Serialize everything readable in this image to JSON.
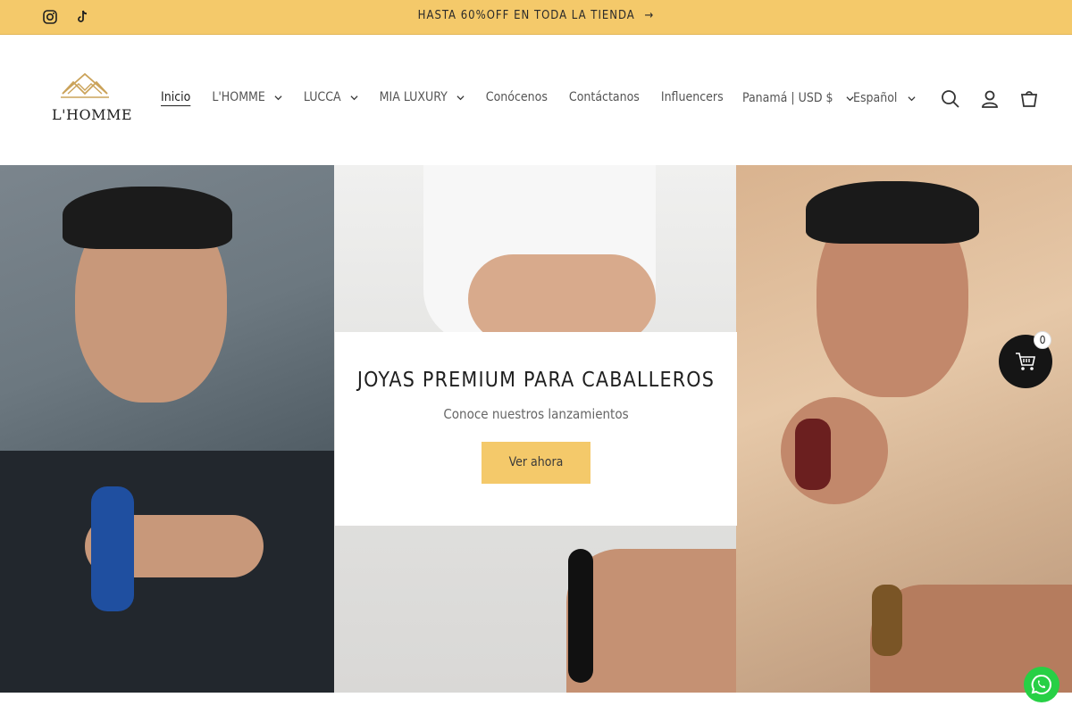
{
  "announcement": {
    "text": "HASTA 60%OFF EN TODA LA TIENDA",
    "arrow": "→",
    "social": [
      "instagram-icon",
      "tiktok-icon"
    ]
  },
  "header": {
    "logo_text": "L'HOMME",
    "nav": [
      {
        "label": "Inicio",
        "dropdown": false,
        "active": true
      },
      {
        "label": "L'HOMME",
        "dropdown": true,
        "active": false
      },
      {
        "label": "LUCCA",
        "dropdown": true,
        "active": false
      },
      {
        "label": "MIA LUXURY",
        "dropdown": true,
        "active": false
      },
      {
        "label": "Conócenos",
        "dropdown": false,
        "active": false
      },
      {
        "label": "Contáctanos",
        "dropdown": false,
        "active": false
      },
      {
        "label": "Influencers",
        "dropdown": false,
        "active": false
      }
    ],
    "locale": "Panamá | USD $",
    "language": "Español",
    "icons": [
      "search-icon",
      "account-icon",
      "cart-icon"
    ]
  },
  "hero": {
    "title": "JOYAS PREMIUM PARA CABALLEROS",
    "subtitle": "Conoce nuestros lanzamientos",
    "button": "Ver ahora"
  },
  "floating_cart": {
    "count": "0"
  },
  "colors": {
    "accent": "#f4c96a",
    "dark": "#151515",
    "whatsapp": "#27d045"
  }
}
